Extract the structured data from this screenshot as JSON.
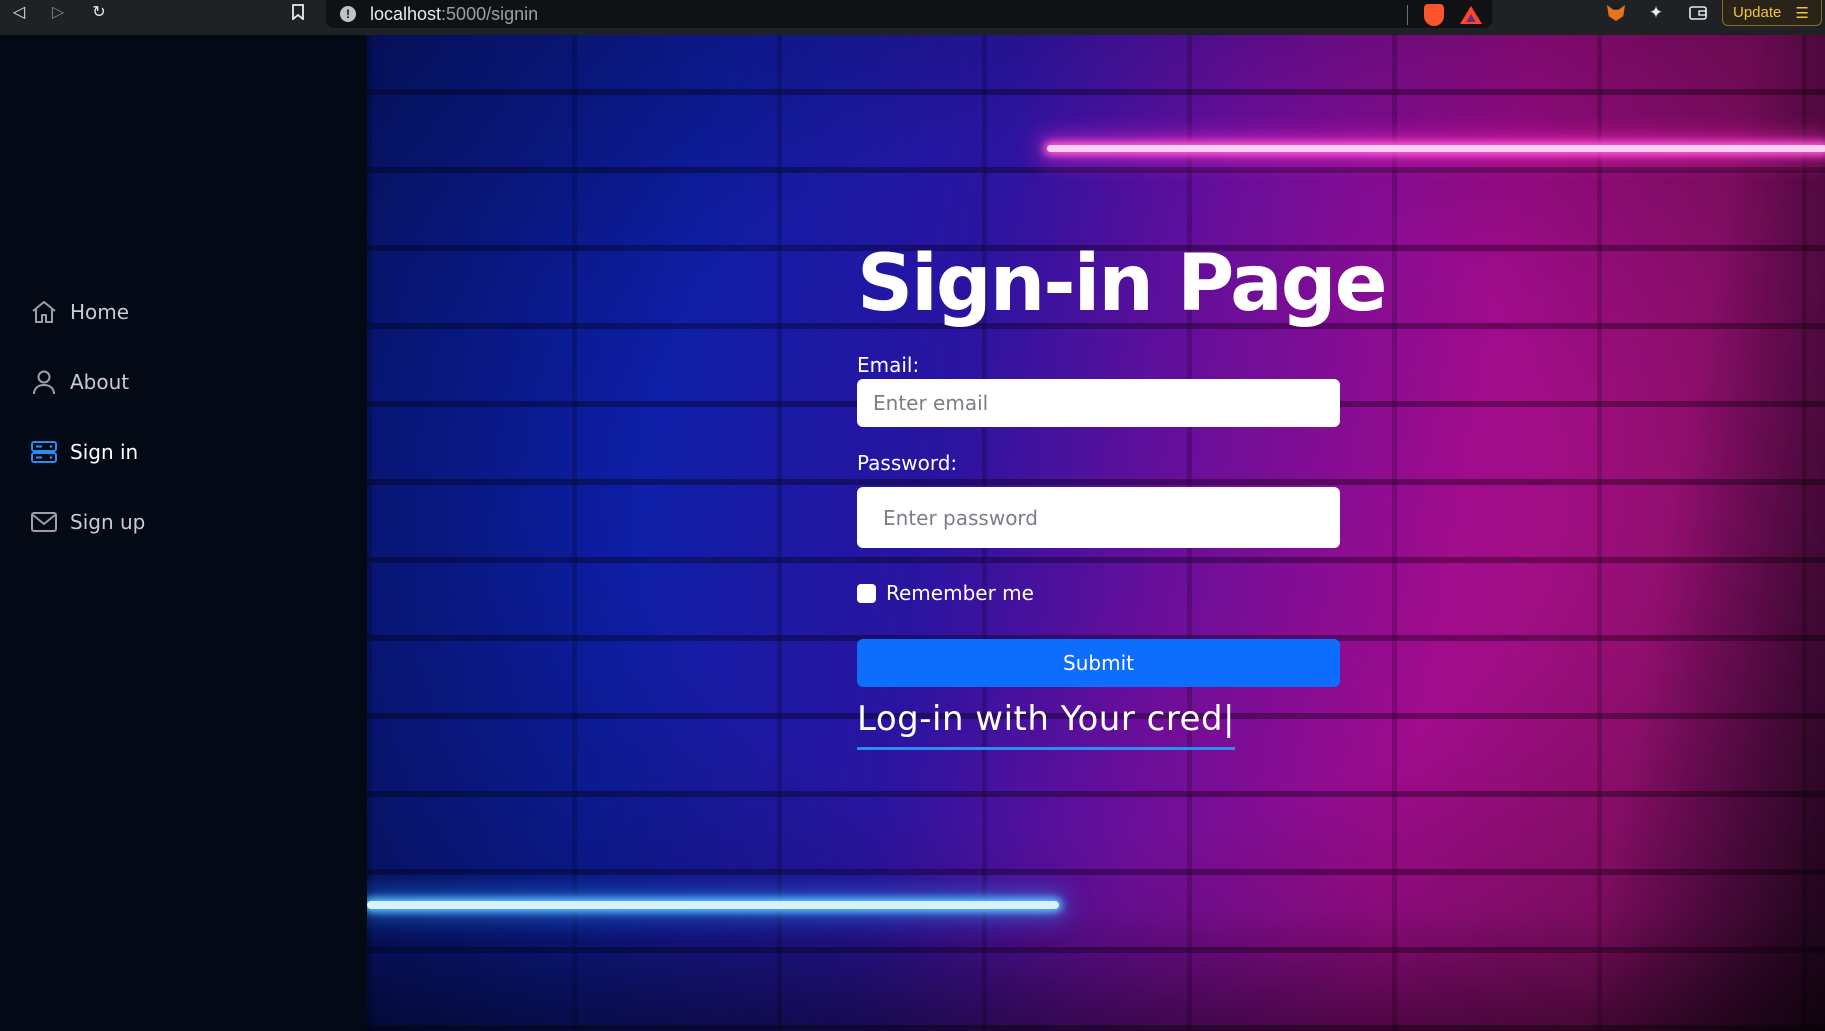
{
  "browser": {
    "url_host": "localhost",
    "url_path": ":5000/signin",
    "update_label": "Update"
  },
  "sidebar": {
    "items": [
      {
        "label": "Home",
        "icon": "home-icon"
      },
      {
        "label": "About",
        "icon": "user-icon"
      },
      {
        "label": "Sign in",
        "icon": "server-icon",
        "active": true
      },
      {
        "label": "Sign up",
        "icon": "mail-icon"
      }
    ],
    "active_color": "#2d8cf0"
  },
  "form": {
    "title": "Sign-in Page",
    "email_label": "Email:",
    "email_placeholder": "Enter email",
    "email_value": "",
    "password_label": "Password:",
    "password_placeholder": "Enter password",
    "password_value": "",
    "remember_label": "Remember me",
    "remember_checked": false,
    "submit_label": "Submit",
    "typing_text": "Log-in with Your cred|"
  },
  "colors": {
    "submit": "#0d6efd",
    "sidebar_bg": "#030a15"
  }
}
